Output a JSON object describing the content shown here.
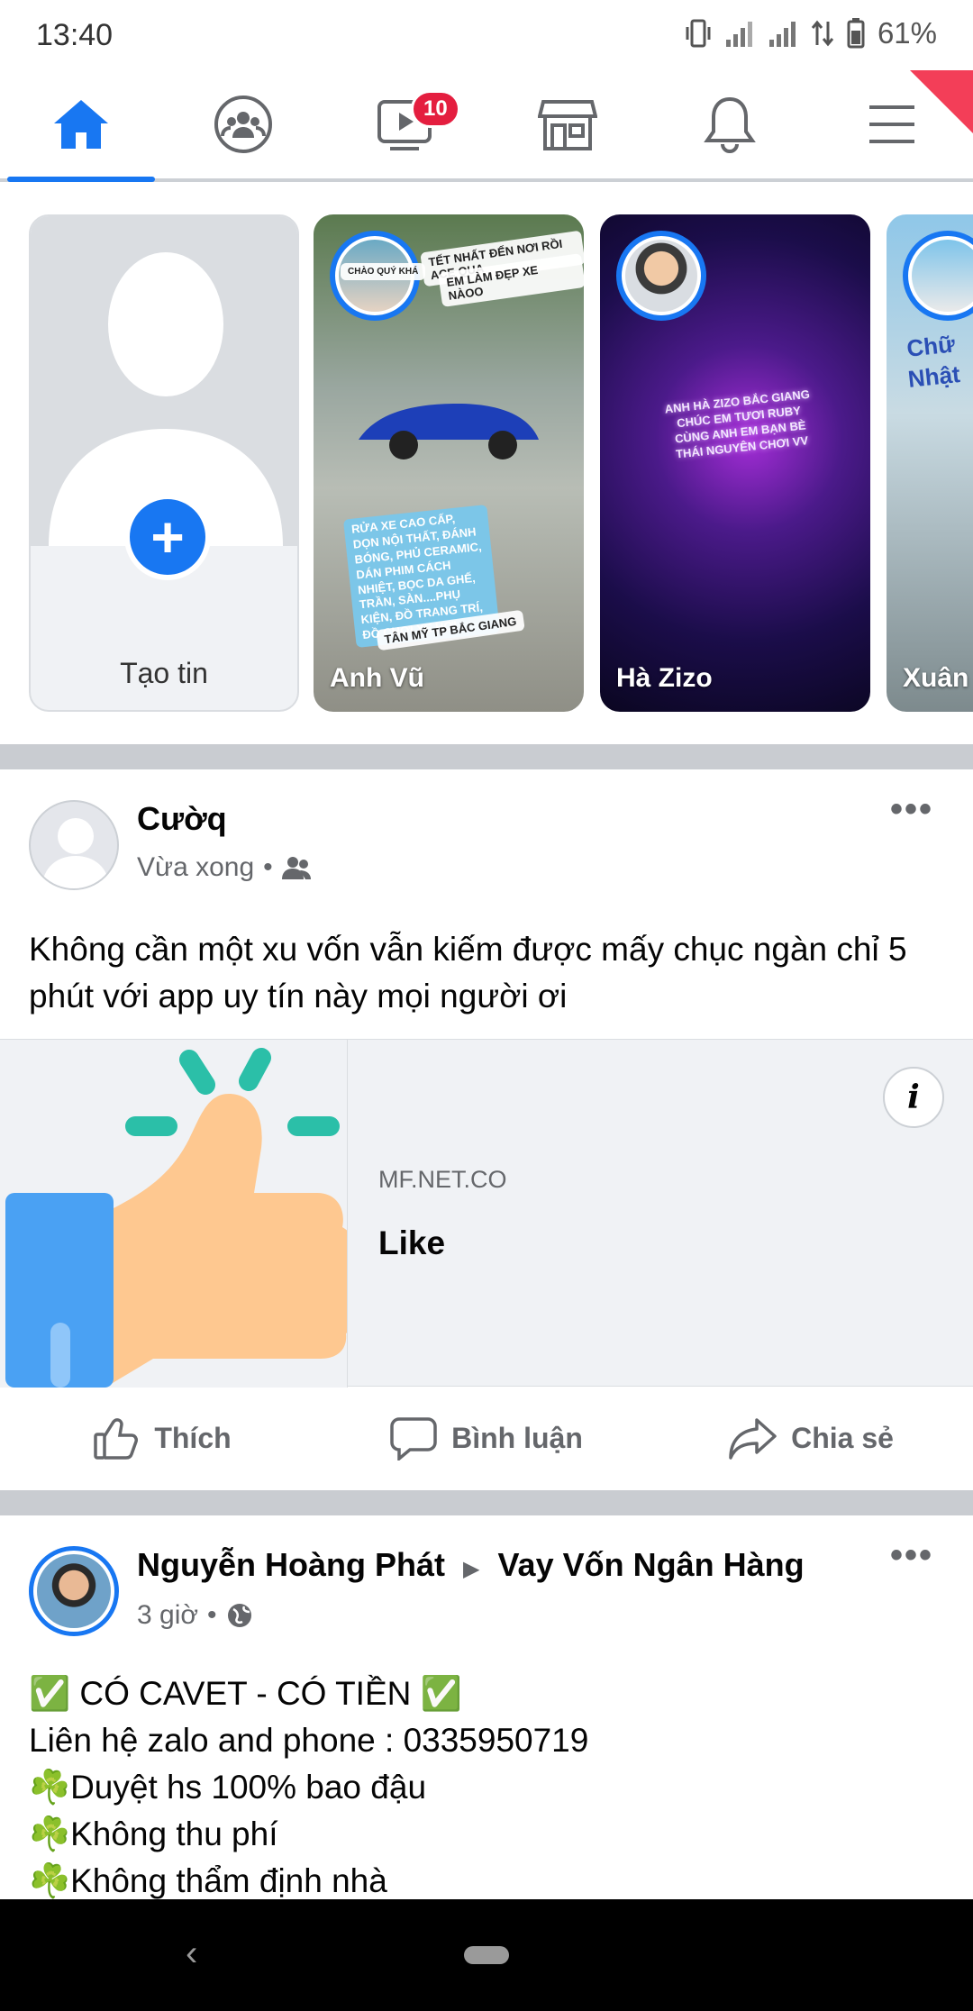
{
  "status_bar": {
    "time": "13:40",
    "battery": "61%"
  },
  "nav": {
    "tabs": [
      {
        "name": "home",
        "active": true
      },
      {
        "name": "groups"
      },
      {
        "name": "watch",
        "badge": "10"
      },
      {
        "name": "marketplace"
      },
      {
        "name": "notifications"
      },
      {
        "name": "menu"
      }
    ]
  },
  "stories": {
    "create_label": "Tạo tin",
    "items": [
      {
        "name": "Anh Vũ"
      },
      {
        "name": "Hà Zizo"
      },
      {
        "name": "Xuân"
      }
    ],
    "story2_texts": [
      "TẾT NHẤT ĐẾN NƠI RỒI ACE QUA",
      "EM LÀM ĐẸP XE NÀOO",
      "RỬA XE CAO CẤP, DỌN NỘI THẤT, ĐÁNH BÓNG, PHỦ CERAMIC, DÁN PHIM CÁCH NHIỆT, BỌC DA GHẾ, TRẦN, SÀN....PHỤ KIỆN, ĐỒ TRANG TRÍ, ĐỒ CHƠI XE HƠI",
      "TÂN MỸ TP BẮC GIANG",
      "CHÀO QUÝ KHÁ"
    ],
    "story3_text": "ANH HÀ ZIZO BẮC GIANG CHÚC EM TƯƠI RUBY CÙNG ANH EM BẠN BÈ THÁI NGUYÊN CHƠI VV",
    "story4_text": "Chữ Nhật"
  },
  "post1": {
    "author": "Cườq",
    "time": "Vừa xong",
    "text": "Không cần một xu vốn vẫn kiếm được mấy chục ngàn chỉ 5 phút với app uy tín này mọi người ơi",
    "link": {
      "domain": "MF.NET.CO",
      "title": "Like"
    },
    "actions": {
      "like": "Thích",
      "comment": "Bình luận",
      "share": "Chia sẻ"
    }
  },
  "post2": {
    "author": "Nguyễn Hoàng Phát",
    "arrow": "▶",
    "group": "Vay Vốn Ngân Hàng",
    "time": "3 giờ",
    "lines": [
      "✅ CÓ CAVET - CÓ TIỀN ✅",
      "Liên hệ zalo and phone : 0335950719",
      "☘️Duyệt hs 100% bao đậu",
      "☘️Không thu phí",
      "☘️Không thẩm định nhà"
    ]
  },
  "colors": {
    "accent": "#1877f2",
    "badge": "#e41e3f",
    "separator": "#c9ccd1"
  }
}
